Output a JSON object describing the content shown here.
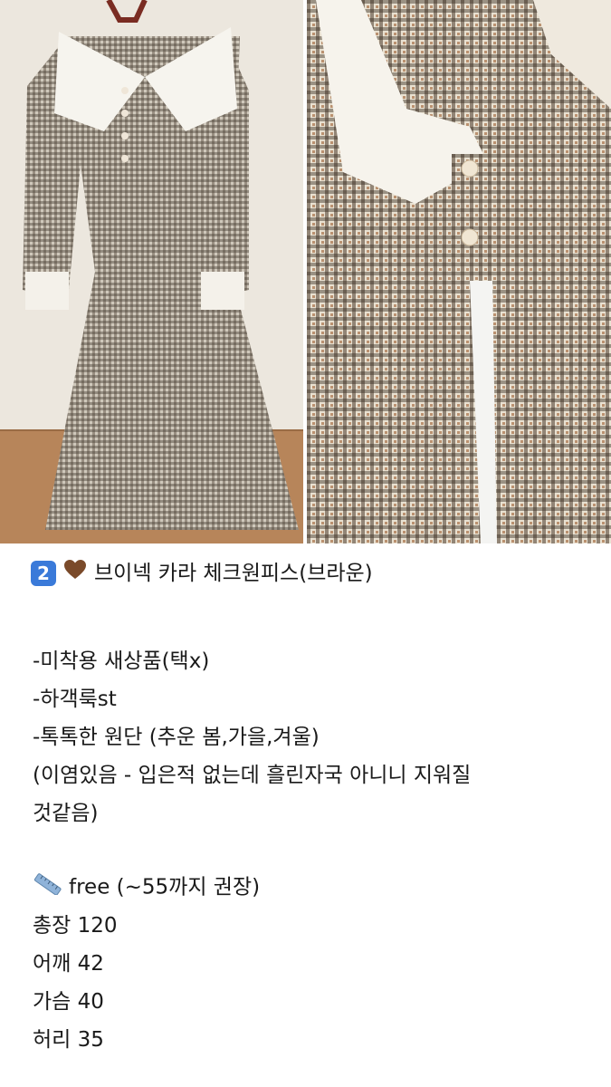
{
  "photos": {
    "left": "photo-full-dress",
    "right": "photo-dress-closeup"
  },
  "post": {
    "title_number": "2",
    "title_heart_icon": "brown-heart-icon",
    "title_text": "브이넥 카라 체크원피스(브라운)",
    "lines": [
      "-미착용 새상품(택x)",
      "-하객룩st",
      "-톡톡한 원단 (추운 봄,가을,겨울)",
      "(이염있음 - 입은적 없는데 흘린자국 아니니 지워질",
      "것같음)"
    ],
    "size_icon": "ruler-icon",
    "size_line": "free (~55까지 권장)",
    "measurements": [
      "총장 120",
      "어깨 42",
      "가슴 40",
      "허리 35"
    ]
  },
  "colors": {
    "keycap": "#3a7ad9",
    "heart": "#7a4a2a",
    "text": "#1a1a1a"
  }
}
